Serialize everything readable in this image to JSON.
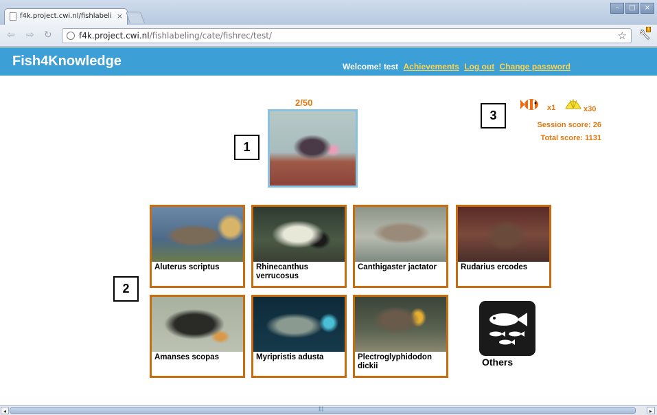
{
  "browser": {
    "tab_title": "f4k.project.cwi.nl/fishlabeli",
    "tab_close": "×",
    "url_host": "f4k.project.cwi.nl",
    "url_path": "/fishlabeling/cate/fishrec/test/",
    "window_buttons": [
      "–",
      "□",
      "×"
    ]
  },
  "header": {
    "logo": "Fish4Knowledge",
    "welcome": "Welcome!",
    "username": "test",
    "links": [
      "Achievements",
      "Log out",
      "Change password"
    ]
  },
  "task": {
    "progress": "2/50"
  },
  "markers": [
    "1",
    "2",
    "3"
  ],
  "stats": {
    "fish_count": "x1",
    "shell_count": "x30",
    "session_score": "Session score: 26",
    "total_score": "Total score: 1131"
  },
  "species": [
    {
      "name": "Aluterus scriptus"
    },
    {
      "name": "Rhinecanthus verrucosus"
    },
    {
      "name": "Canthigaster jactator"
    },
    {
      "name": "Rudarius ercodes"
    },
    {
      "name": "Amanses scopas"
    },
    {
      "name": "Myripristis adusta"
    },
    {
      "name": "Plectroglyphidodon dickii"
    }
  ],
  "others_label": "Others",
  "colors": {
    "header_blue": "#3c9fd6",
    "accent_orange": "#e07a10",
    "card_border": "#c86c12",
    "link_yellow": "#ffd24a"
  }
}
